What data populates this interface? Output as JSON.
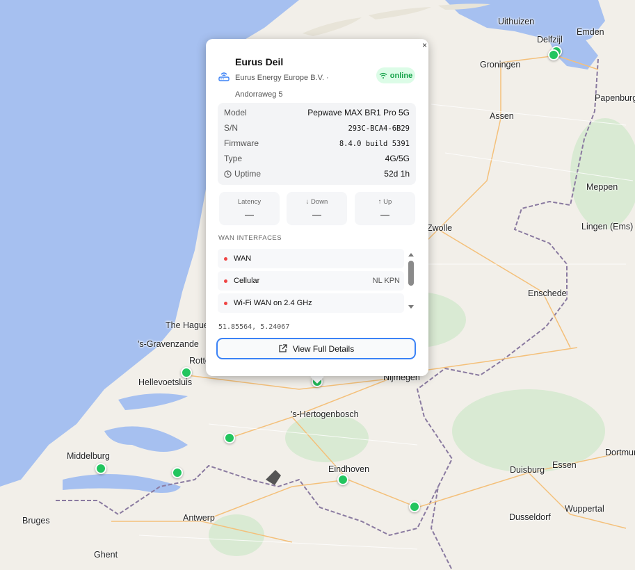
{
  "map": {
    "cities": [
      {
        "name": "Uithuizen"
      },
      {
        "name": "Delfzijl"
      },
      {
        "name": "Emden"
      },
      {
        "name": "Groningen"
      },
      {
        "name": "Papenburg"
      },
      {
        "name": "Assen"
      },
      {
        "name": "Meppen"
      },
      {
        "name": "Zwolle"
      },
      {
        "name": "Lingen (Ems)"
      },
      {
        "name": "Enschede"
      },
      {
        "name": "The Hague"
      },
      {
        "name": "'s-Gravenzande"
      },
      {
        "name": "Rotterdam"
      },
      {
        "name": "Hellevoetsluis"
      },
      {
        "name": "Nijmegen"
      },
      {
        "name": "'s-Hertogenbosch"
      },
      {
        "name": "Middelburg"
      },
      {
        "name": "Eindhoven"
      },
      {
        "name": "Duisburg"
      },
      {
        "name": "Essen"
      },
      {
        "name": "Dortmund"
      },
      {
        "name": "Bruges"
      },
      {
        "name": "Antwerp"
      },
      {
        "name": "Dusseldorf"
      },
      {
        "name": "Wuppertal"
      },
      {
        "name": "Ghent"
      }
    ],
    "marker_color": "#22c55e"
  },
  "popup": {
    "close_label": "×",
    "title": "Eurus Deil",
    "owner_line1": "Eurus Energy Europe B.V. ·",
    "owner_line2": "Andorraweg 5",
    "status": "online",
    "specs": [
      {
        "key": "Model",
        "value": "Pepwave MAX BR1 Pro 5G"
      },
      {
        "key": "S/N",
        "value": "293C-BCA4-6B29"
      },
      {
        "key": "Firmware",
        "value": "8.4.0 build 5391"
      },
      {
        "key": "Type",
        "value": "4G/5G"
      },
      {
        "key": "Uptime",
        "value": "52d 1h"
      }
    ],
    "metrics": [
      {
        "label": "Latency",
        "value": "—"
      },
      {
        "label": "Down",
        "value": "—"
      },
      {
        "label": "Up",
        "value": "—"
      }
    ],
    "wan_heading": "WAN INTERFACES",
    "wan": [
      {
        "name": "WAN",
        "carrier": ""
      },
      {
        "name": "Cellular",
        "carrier": "NL KPN"
      },
      {
        "name": "Wi-Fi WAN on 2.4 GHz",
        "carrier": ""
      }
    ],
    "coordinates": "51.85564, 5.24067",
    "button_label": "View Full Details",
    "status_color": "#16a34a",
    "accent_color": "#3b82f6"
  }
}
